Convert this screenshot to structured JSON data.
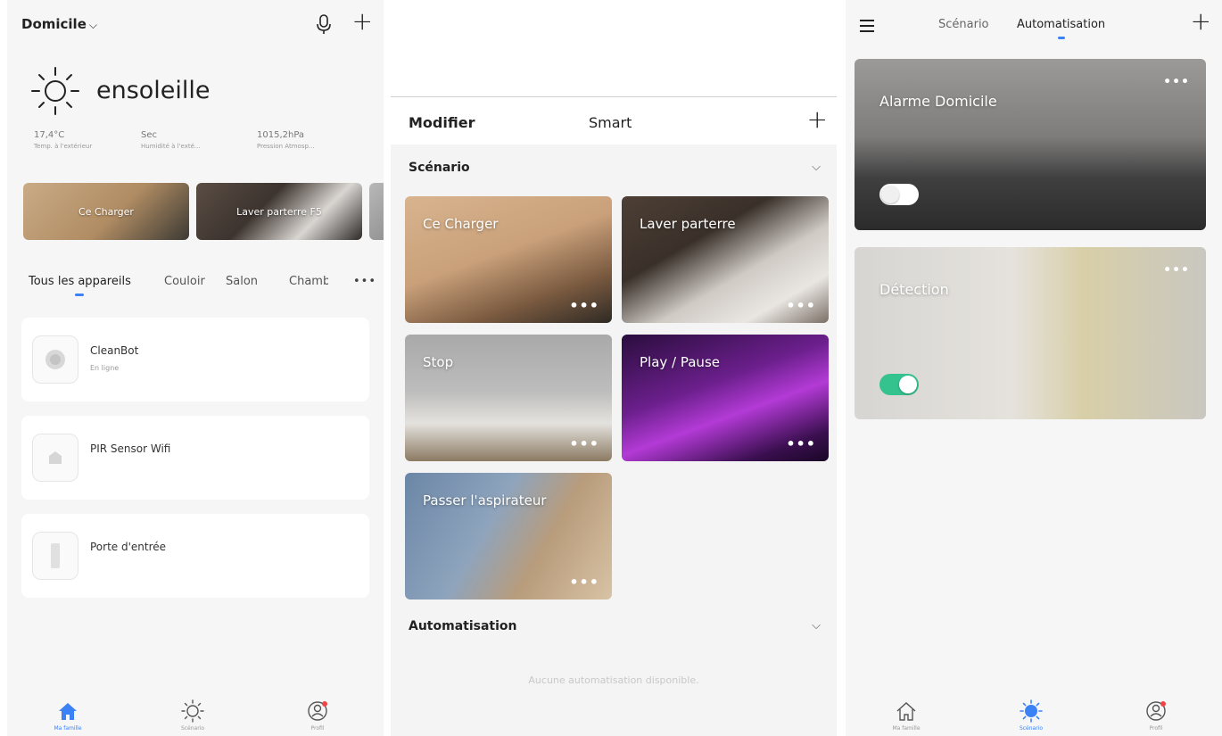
{
  "panel1": {
    "home_label": "Domicile",
    "weather_title": "ensoleille",
    "stats": [
      {
        "value": "17,4°C",
        "label": "Temp. à l'extérieur"
      },
      {
        "value": "Sec",
        "label": "Humidité à l'exté..."
      },
      {
        "value": "1015,2hPa",
        "label": "Pression Atmosp..."
      }
    ],
    "mini_scenes": [
      "Ce Charger",
      "Laver parterre F5"
    ],
    "rooms": [
      "Tous les appareils",
      "Couloir",
      "Salon",
      "Chambre"
    ],
    "more": "•••",
    "devices": [
      {
        "name": "CleanBot",
        "status": "En ligne"
      },
      {
        "name": "PIR Sensor Wifi",
        "status": ""
      },
      {
        "name": "Porte d'entrée",
        "status": ""
      }
    ],
    "nav": [
      "Ma famille",
      "Scénario",
      "Profil"
    ]
  },
  "panel2": {
    "modify": "Modifier",
    "title": "Smart",
    "plus": "+",
    "section_scenes": "Scénario",
    "section_auto": "Automatisation",
    "scenes": [
      {
        "label": "Ce Charger",
        "dots": "•••"
      },
      {
        "label": "Laver parterre",
        "dots": "•••"
      },
      {
        "label": "Stop",
        "dots": "•••"
      },
      {
        "label": "Play / Pause",
        "dots": "•••"
      },
      {
        "label": "Passer l'aspirateur",
        "dots": "•••"
      }
    ],
    "empty_note": "Aucune automatisation disponible."
  },
  "panel3": {
    "tabs": [
      "Scénario",
      "Automatisation"
    ],
    "plus": "+",
    "cards": [
      {
        "label": "Alarme Domicile",
        "dots": "•••",
        "enabled": false
      },
      {
        "label": "Détection",
        "dots": "•••",
        "enabled": true
      }
    ],
    "nav": [
      "Ma famille",
      "Scénario",
      "Profil"
    ]
  },
  "colors": {
    "accent": "#3b82f6",
    "toggle_on": "#34c38f",
    "toggle_off": "#ffffff",
    "badge": "#ef4444"
  }
}
